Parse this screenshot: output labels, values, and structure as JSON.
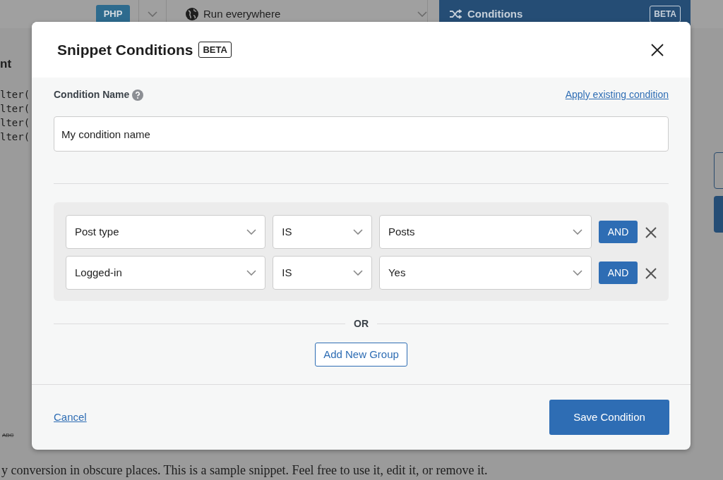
{
  "background": {
    "type_badge": "PHP",
    "location": "Run everywhere",
    "conditions_panel": {
      "title": "Conditions",
      "badge": "BETA"
    },
    "heading_fragment": "nt",
    "code_lines": [
      "lter(",
      "lter(",
      "lter(",
      "lter("
    ],
    "toolbar_glyph": "ABC",
    "description": "y conversion in obscure places. This is a sample snippet. Feel free to use it, edit it, or remove it."
  },
  "modal": {
    "title": "Snippet Conditions",
    "badge": "BETA",
    "name_label": "Condition Name",
    "apply_link": "Apply existing condition",
    "name_value": "My condition name",
    "groups": [
      {
        "rules": [
          {
            "field": "Post type",
            "operator": "IS",
            "value": "Posts",
            "join": "AND"
          },
          {
            "field": "Logged-in",
            "operator": "IS",
            "value": "Yes",
            "join": "AND"
          }
        ]
      }
    ],
    "separator": "OR",
    "add_group": "Add New Group",
    "cancel": "Cancel",
    "save": "Save Condition"
  }
}
